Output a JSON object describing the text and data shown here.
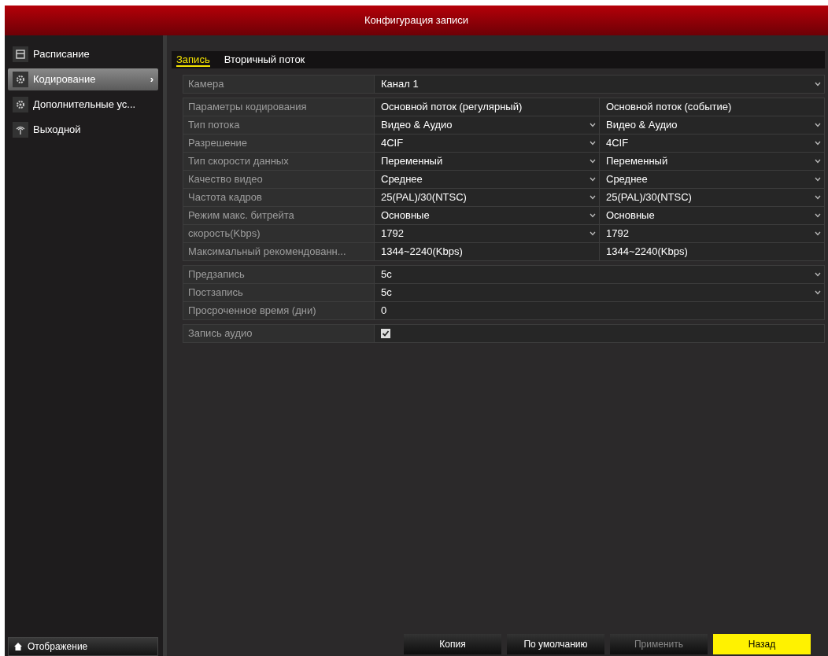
{
  "window": {
    "title": "Конфигурация записи"
  },
  "sidebar": {
    "items": [
      {
        "label": "Расписание",
        "selected": false
      },
      {
        "label": "Кодирование",
        "selected": true,
        "arrow": "›"
      },
      {
        "label": "Дополнительные ус...",
        "selected": false
      },
      {
        "label": "Выходной",
        "selected": false
      }
    ],
    "footer": {
      "label": "Отображение"
    }
  },
  "tabs": [
    {
      "label": "Запись",
      "selected": true
    },
    {
      "label": "Вторичный поток",
      "selected": false
    }
  ],
  "groups": [
    [
      {
        "label": "Камера",
        "kind": "select",
        "values": [
          "Канал 1"
        ]
      }
    ],
    [
      {
        "label": "Параметры кодирования",
        "kind": "text",
        "values": [
          "Основной поток (регулярный)",
          "Основной поток (событие)"
        ]
      },
      {
        "label": "Тип потока",
        "kind": "select",
        "values": [
          "Видео & Аудио",
          "Видео & Аудио"
        ]
      },
      {
        "label": "Разрешение",
        "kind": "select",
        "values": [
          "4CIF",
          "4CIF"
        ]
      },
      {
        "label": "Тип скорости данных",
        "kind": "select",
        "values": [
          "Переменный",
          "Переменный"
        ]
      },
      {
        "label": "Качество видео",
        "kind": "select",
        "values": [
          "Среднее",
          "Среднее"
        ]
      },
      {
        "label": "Частота кадров",
        "kind": "select",
        "values": [
          "25(PAL)/30(NTSC)",
          "25(PAL)/30(NTSC)"
        ]
      },
      {
        "label": "Режим макс. битрейта",
        "kind": "select",
        "values": [
          "Основные",
          "Основные"
        ]
      },
      {
        "label": "скорость(Kbps)",
        "kind": "select",
        "values": [
          "1792",
          "1792"
        ]
      },
      {
        "label": "Максимальный рекомендованн...",
        "kind": "text",
        "values": [
          "1344~2240(Kbps)",
          "1344~2240(Kbps)"
        ]
      }
    ],
    [
      {
        "label": "Предзапись",
        "kind": "select",
        "values": [
          "5с"
        ]
      },
      {
        "label": "Постзапись",
        "kind": "select",
        "values": [
          "5с"
        ]
      },
      {
        "label": "Просроченное время (дни)",
        "kind": "text",
        "values": [
          "0"
        ]
      }
    ],
    [
      {
        "label": "Запись аудио",
        "kind": "checkbox",
        "checked": true
      }
    ]
  ],
  "buttons": [
    {
      "label": "Копия",
      "kind": "normal",
      "disabled": false
    },
    {
      "label": "По умолчанию",
      "kind": "normal",
      "disabled": false
    },
    {
      "label": "Применить",
      "kind": "normal",
      "disabled": true
    },
    {
      "label": "Назад",
      "kind": "primary",
      "disabled": false
    }
  ]
}
